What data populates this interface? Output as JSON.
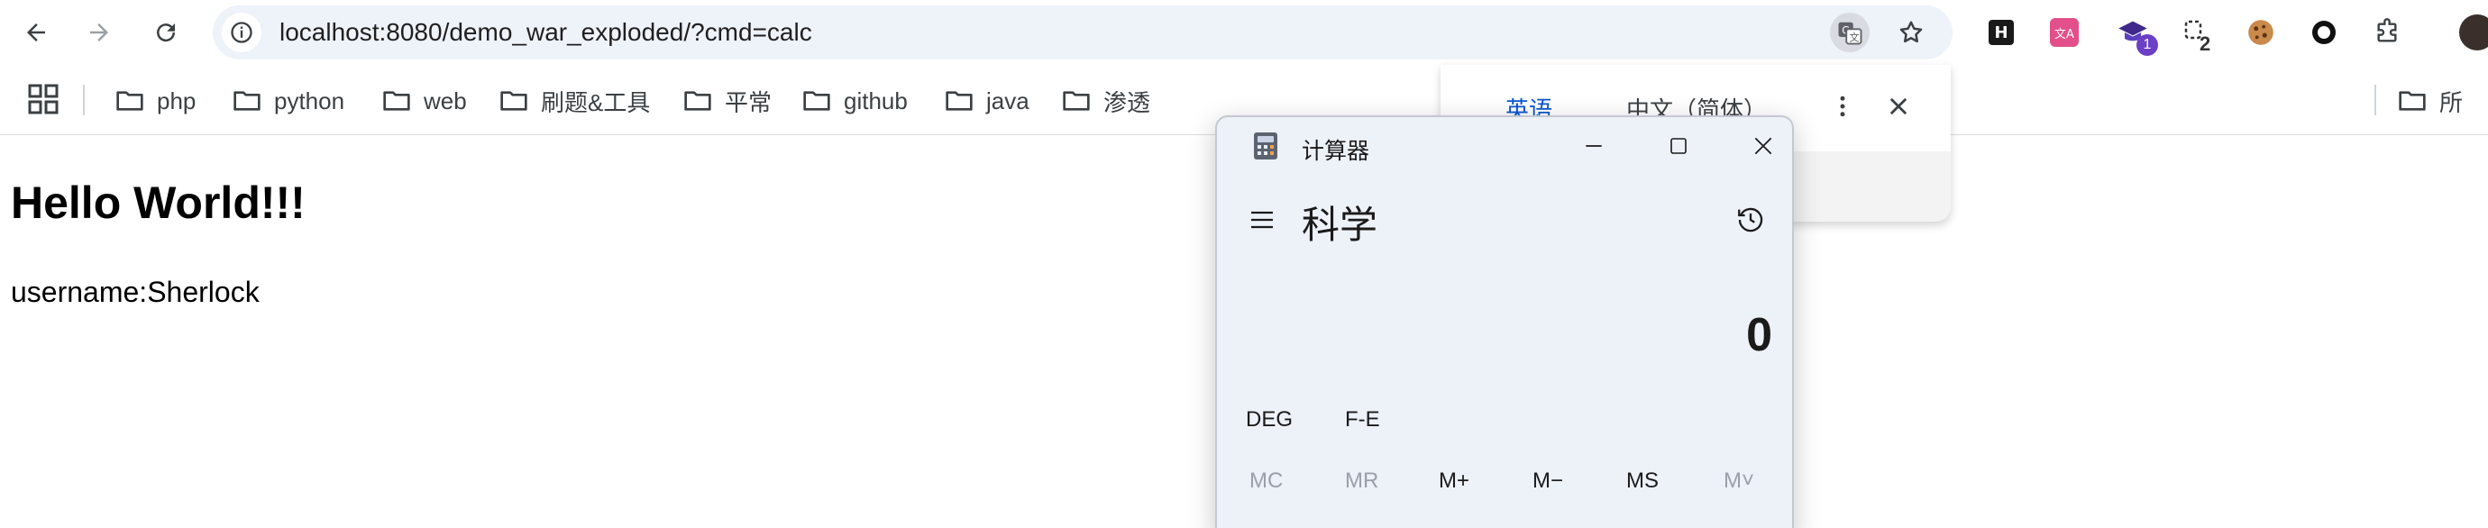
{
  "browser": {
    "url": "localhost:8080/demo_war_exploded/?cmd=calc",
    "extensions": [
      {
        "name": "extension-h",
        "label": "H",
        "bg": "#1a1a1a"
      },
      {
        "name": "extension-translate",
        "label": "文A",
        "bg": "#e34f8a"
      },
      {
        "name": "extension-badge-1",
        "label": "1",
        "bg": "#6c3fc7"
      },
      {
        "name": "extension-badge-2",
        "label": "2",
        "bg": "#333333"
      }
    ]
  },
  "bookmarks": [
    {
      "label": "php"
    },
    {
      "label": "python"
    },
    {
      "label": "web"
    },
    {
      "label": "刷题&工具"
    },
    {
      "label": "平常"
    },
    {
      "label": "github"
    },
    {
      "label": "java"
    },
    {
      "label": "渗透"
    }
  ],
  "bookmarks_overflow_label": "所",
  "page": {
    "heading": "Hello World!!!",
    "user_line": "username:Sherlock"
  },
  "translate_popup": {
    "source_lang": "英语",
    "target_lang": "中文（简体）"
  },
  "calculator": {
    "app_title": "计算器",
    "mode": "科学",
    "display": "0",
    "options": [
      "DEG",
      "F-E"
    ],
    "memory": [
      {
        "label": "MC",
        "enabled": false
      },
      {
        "label": "MR",
        "enabled": false
      },
      {
        "label": "M+",
        "enabled": true
      },
      {
        "label": "M−",
        "enabled": true
      },
      {
        "label": "MS",
        "enabled": true
      },
      {
        "label": "M˅",
        "enabled": false
      }
    ]
  },
  "colors": {
    "accent": "#0b57d0",
    "omnibox_bg": "#eef2f9",
    "calc_bg": "#edf1f8"
  }
}
